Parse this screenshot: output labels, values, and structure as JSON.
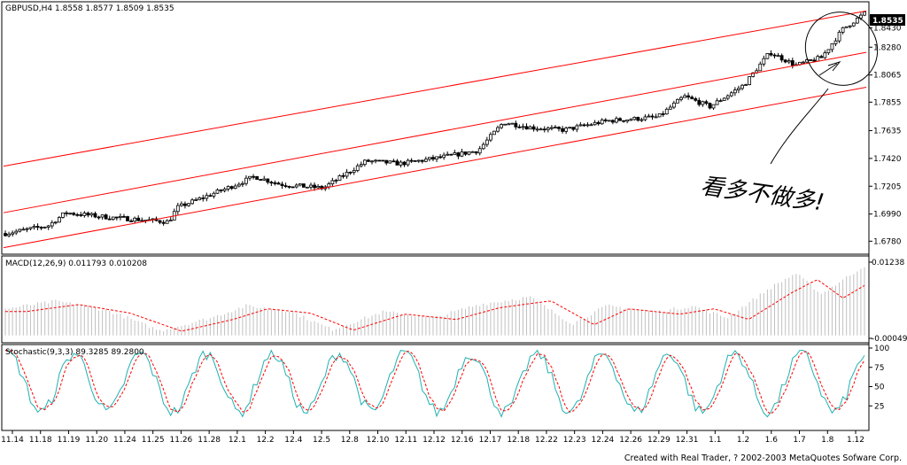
{
  "chart_data": [
    {
      "type": "candlestick",
      "title": "GBPUSD,H4  1.8558 1.8577 1.8509 1.8535",
      "last_price": "1.8535",
      "y_ticks": [
        "1.8430",
        "1.8280",
        "1.8065",
        "1.7855",
        "1.7635",
        "1.7420",
        "1.7205",
        "1.6990",
        "1.6780"
      ],
      "ylim": [
        1.67,
        1.859
      ],
      "channel_lines": [
        {
          "start": [
            0,
            1.736
          ],
          "end": [
            1,
            1.856
          ]
        },
        {
          "start": [
            0,
            1.7
          ],
          "end": [
            1,
            1.824
          ]
        },
        {
          "start": [
            0,
            1.673
          ],
          "end": [
            1,
            1.797
          ]
        }
      ],
      "handwritten_annotation": "看多不做多!",
      "line_color": "#ff0000"
    },
    {
      "type": "bar",
      "title": "MACD(12,26,9)  0.011793  0.010208",
      "y_ticks": [
        "0.01238",
        "-0.00049"
      ],
      "ylim": [
        -0.00049,
        0.01238
      ],
      "signal_color": "#ff0000",
      "bar_color": "#c0c0c0"
    },
    {
      "type": "line",
      "title": "Stochastic(9,3,3)  89.3285  89.2800",
      "y_ticks": [
        "100",
        "75",
        "50",
        "25"
      ],
      "ylim": [
        0,
        100
      ],
      "series": [
        {
          "name": "",
          "color": "#20b0b0"
        },
        {
          "name": "",
          "color": "#ff0000"
        }
      ]
    }
  ],
  "x_ticks": [
    "11.14",
    "11.18",
    "11.19",
    "11.20",
    "11.24",
    "11.25",
    "11.26",
    "11.28",
    "12.1",
    "12.2",
    "12.4",
    "12.5",
    "12.8",
    "12.10",
    "12.11",
    "12.12",
    "12.16",
    "12.17",
    "12.18",
    "12.22",
    "12.23",
    "12.24",
    "12.26",
    "12.29",
    "12.31",
    "1.1",
    "1.2",
    "1.6",
    "1.7",
    "1.8",
    "1.12"
  ],
  "footer": "Created with Real Trader, ? 2002-2003 MetaQuotes Sofware Corp."
}
